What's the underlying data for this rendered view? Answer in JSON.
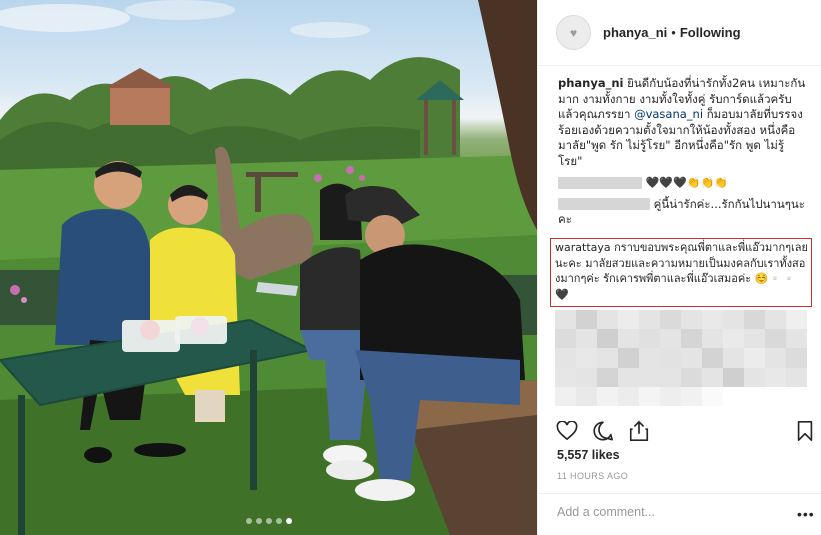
{
  "header": {
    "username": "phanya_ni",
    "separator": "•",
    "follow_status": "Following"
  },
  "caption": {
    "username": "phanya_ni",
    "text_before_mention": "ยินดีกับน้องที่น่ารักทั้ง2คน เหมาะกันมาก งามทั้งกาย งามทั้งใจทั้งคู่ รับการ์ดแล้วครับ แล้วคุณภรรยา",
    "mention": "@vasana_ni",
    "text_after_mention": "ก็มอบมาลัยที่บรรจงร้อยเองด้วยความตั้งใจมากให้น้องทั้งสอง หนึ่งคือมาลัย\"พูด รัก ไม่รู้โรย\" อีกหนึ่งคือ\"รัก พูด ไม่รู้โรย\""
  },
  "comments": [
    {
      "text": "🖤🖤🖤👏👏👏"
    },
    {
      "text": "คู่นี้น่ารักค่ะ...รักกันไปนานๆนะคะ"
    }
  ],
  "highlighted_comment": {
    "username": "warattaya",
    "text": "กราบขอบพระคุณพี่ตาและพี่แอ๊วมากๆเลยนะคะ มาลัยสวยและความหมายเป็นมงคลกับเราทั้งสองมากๆค่ะ รักเคารพพี่ตาและพี่แอ๊วเสมอค่ะ ☺️▫️▫️🖤"
  },
  "likes": "5,557 likes",
  "timestamp": "11 HOURS AGO",
  "add_comment_placeholder": "Add a comment...",
  "more_label": "•••",
  "carousel": {
    "count": 5,
    "active_index": 4
  },
  "icons": {
    "like": "heart-icon",
    "comment": "comment-bubble-icon",
    "share": "share-icon",
    "save": "bookmark-icon"
  }
}
